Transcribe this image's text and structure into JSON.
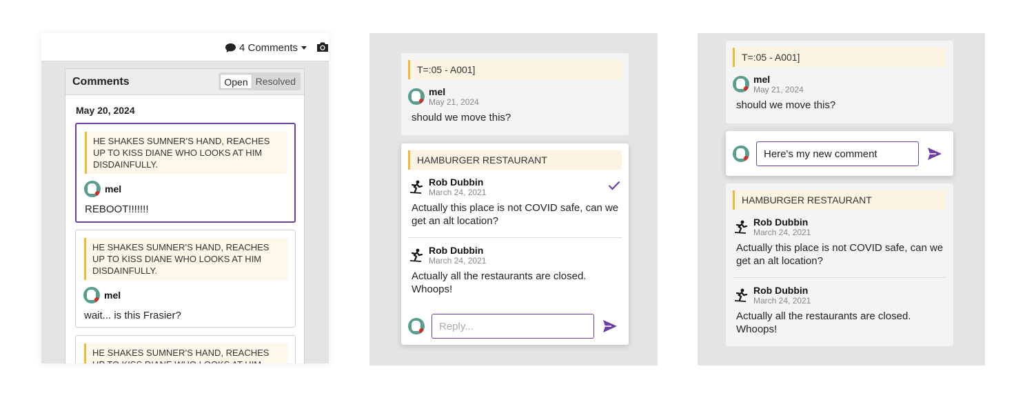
{
  "panel1": {
    "comments_count_label": "4 Comments",
    "box_title": "Comments",
    "filter": {
      "open": "Open",
      "resolved": "Resolved"
    },
    "date_heading": "May 20, 2024",
    "cards": [
      {
        "quote": "HE SHAKES SUMNER’S HAND, REACHES UP TO KISS DIANE WHO LOOKS AT HIM DISDAINFULLY.",
        "author": "mel",
        "text": "REBOOT!!!!!!!"
      },
      {
        "quote": "HE SHAKES SUMNER’S HAND, REACHES UP TO KISS DIANE WHO LOOKS AT HIM DISDAINFULLY.",
        "author": "mel",
        "text": "wait... is this Frasier?"
      },
      {
        "quote": "HE SHAKES SUMNER’S HAND, REACHES UP TO KISS DIANE WHO LOOKS AT HIM"
      }
    ]
  },
  "panel2": {
    "thread1": {
      "quote": "T=:05 - A001]",
      "author": "mel",
      "date": "May 21, 2024",
      "text": "should we move this?"
    },
    "thread2": {
      "quote": "HAMBURGER RESTAURANT",
      "comments": [
        {
          "author": "Rob Dubbin",
          "date": "March 24, 2021",
          "text": "Actually this place is not COVID safe, can we get an alt location?"
        },
        {
          "author": "Rob Dubbin",
          "date": "March 24, 2021",
          "text": "Actually all the restaurants are closed. Whoops!"
        }
      ],
      "reply_placeholder": "Reply..."
    }
  },
  "panel3": {
    "thread1": {
      "quote": "T=:05 - A001]",
      "author": "mel",
      "date": "May 21, 2024",
      "text": "should we move this?"
    },
    "new_comment_value": "Here's my new comment",
    "thread2": {
      "quote": "HAMBURGER RESTAURANT",
      "comments": [
        {
          "author": "Rob Dubbin",
          "date": "March 24, 2021",
          "text": "Actually this place is not COVID safe, can we get an alt location?"
        },
        {
          "author": "Rob Dubbin",
          "date": "March 24, 2021",
          "text": "Actually all the restaurants are closed. Whoops!"
        }
      ]
    }
  },
  "colors": {
    "accent": "#6b3fa0",
    "quote_bar": "#f0b840",
    "panel_bg": "#e4e4e4"
  },
  "icons": [
    "comment-bubble-icon",
    "caret-down-icon",
    "camera-icon",
    "avatar-mel",
    "avatar-rob-skater",
    "checkmark-icon",
    "send-icon"
  ]
}
